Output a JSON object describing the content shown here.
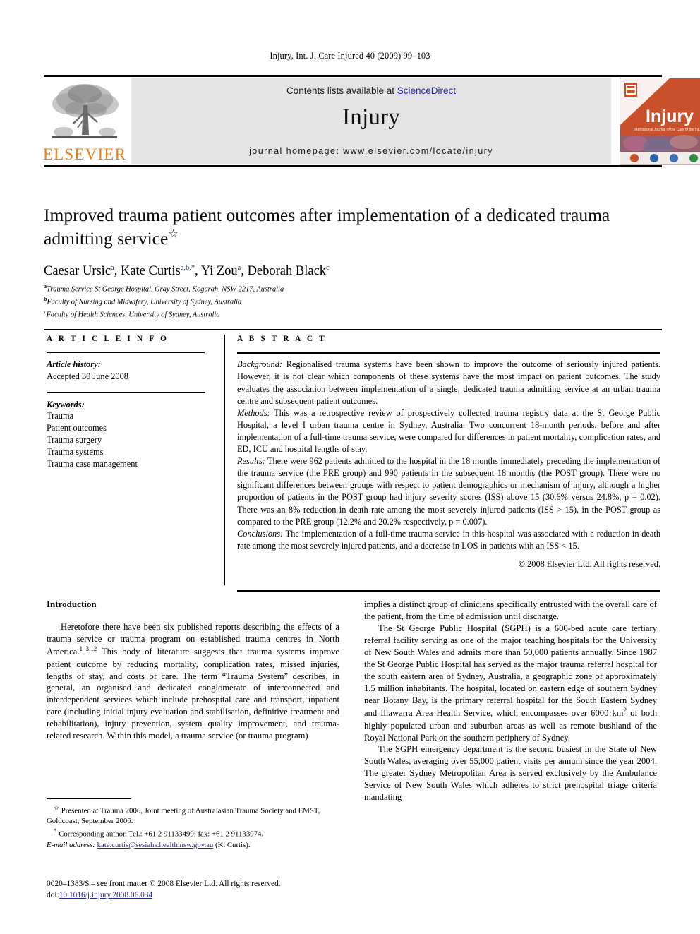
{
  "running_head": "Injury, Int. J. Care Injured 40 (2009) 99–103",
  "masthead": {
    "publisher_wordmark": "ELSEVIER",
    "contents_prefix": "Contents lists available at ",
    "contents_link": "ScienceDirect",
    "journal_name": "Injury",
    "homepage": "journal homepage: www.elsevier.com/locate/injury",
    "cover_title": "Injury",
    "cover_subtitle": "International Journal of the Care of the Injured",
    "colors": {
      "elsevier_orange": "#F07F13",
      "link_blue": "#2c2c8f",
      "banner_grey": "#e4e4e4",
      "cover_orange": "#C8502A"
    }
  },
  "article": {
    "title": "Improved trauma patient outcomes after implementation of a dedicated trauma admitting service",
    "title_symbol": "☆",
    "authors": [
      {
        "name": "Caesar Ursic",
        "sup": "a"
      },
      {
        "name": "Kate Curtis",
        "sup": "a,b,*"
      },
      {
        "name": "Yi Zou",
        "sup": "a"
      },
      {
        "name": "Deborah Black",
        "sup": "c"
      }
    ],
    "affiliations": [
      {
        "marker": "a",
        "text": "Trauma Service St George Hospital, Gray Street, Kogarah, NSW 2217, Australia"
      },
      {
        "marker": "b",
        "text": "Faculty of Nursing and Midwifery, University of Sydney, Australia"
      },
      {
        "marker": "c",
        "text": "Faculty of Health Sciences, University of Sydney, Australia"
      }
    ]
  },
  "article_info": {
    "heading": "A R T I C L E  I N F O",
    "history_label": "Article history:",
    "history_value": "Accepted 30 June 2008",
    "keywords_label": "Keywords:",
    "keywords": [
      "Trauma",
      "Patient outcomes",
      "Trauma surgery",
      "Trauma systems",
      "Trauma case management"
    ]
  },
  "abstract": {
    "heading": "A B S T R A C T",
    "sections": [
      {
        "label": "Background:",
        "text": " Regionalised trauma systems have been shown to improve the outcome of seriously injured patients. However, it is not clear which components of these systems have the most impact on patient outcomes. The study evaluates the association between implementation of a single, dedicated trauma admitting service at an urban trauma centre and subsequent patient outcomes."
      },
      {
        "label": "Methods:",
        "text": " This was a retrospective review of prospectively collected trauma registry data at the St George Public Hospital, a level I urban trauma centre in Sydney, Australia. Two concurrent 18-month periods, before and after implementation of a full-time trauma service, were compared for differences in patient mortality, complication rates, and ED, ICU and hospital lengths of stay."
      },
      {
        "label": "Results:",
        "text": " There were 962 patients admitted to the hospital in the 18 months immediately preceding the implementation of the trauma service (the PRE group) and 990 patients in the subsequent 18 months (the POST group). There were no significant differences between groups with respect to patient demographics or mechanism of injury, although a higher proportion of patients in the POST group had injury severity scores (ISS) above 15 (30.6% versus 24.8%, p = 0.02). There was an 8% reduction in death rate among the most severely injured patients (ISS > 15), in the POST group as compared to the PRE group (12.2% and 20.2% respectively, p = 0.007)."
      },
      {
        "label": "Conclusions:",
        "text": " The implementation of a full-time trauma service in this hospital was associated with a reduction in death rate among the most severely injured patients, and a decrease in LOS in patients with an ISS < 15."
      }
    ],
    "copyright": "© 2008 Elsevier Ltd. All rights reserved."
  },
  "body": {
    "section_heading": "Introduction",
    "left_paragraph_1": "Heretofore there have been six published reports describing the effects of a trauma service or trauma program on established trauma centres in North America.",
    "left_ref_1": "1–3,12",
    "left_paragraph_1_cont": " This body of literature suggests that trauma systems improve patient outcome by reducing mortality, complication rates, missed injuries, lengths of stay, and costs of care. The term “Trauma System” describes, in general, an organised and dedicated conglomerate of interconnected and interdependent services which include prehospital care and transport, inpatient care (including initial injury evaluation and stabilisation, definitive treatment and rehabilitation), injury prevention, system quality improvement, and trauma-related research. Within this model, a trauma service (or trauma program)",
    "right_paragraph_1": "implies a distinct group of clinicians specifically entrusted with the overall care of the patient, from the time of admission until discharge.",
    "right_paragraph_2": "The St George Public Hospital (SGPH) is a 600-bed acute care tertiary referral facility serving as one of the major teaching hospitals for the University of New South Wales and admits more than 50,000 patients annually. Since 1987 the St George Public Hospital has served as the major trauma referral hospital for the south eastern area of Sydney, Australia, a geographic zone of approximately 1.5 million inhabitants. The hospital, located on eastern edge of southern Sydney near Botany Bay, is the primary referral hospital for the South Eastern Sydney and Illawarra Area Health Service, which encompasses over 6000 km",
    "right_paragraph_2_sup": "2",
    "right_paragraph_2_cont": " of both highly populated urban and suburban areas as well as remote bushland of the Royal National Park on the southern periphery of Sydney.",
    "right_paragraph_3": "The SGPH emergency department is the second busiest in the State of New South Wales, averaging over 55,000 patient visits per annum since the year 2004. The greater Sydney Metropolitan Area is served exclusively by the Ambulance Service of New South Wales which adheres to strict prehospital triage criteria mandating"
  },
  "footnotes": {
    "star_note": "Presented at Trauma 2006, Joint meeting of Australasian Trauma Society and EMST, Goldcoast, September 2006.",
    "star_symbol": "☆",
    "corresponding_symbol": "*",
    "corresponding_note": "Corresponding author. Tel.: +61 2 91133499; fax: +61 2 91133974.",
    "email_label": "E-mail address:",
    "email": "kate.curtis@sesiahs.health.nsw.gov.au",
    "email_owner": "(K. Curtis)."
  },
  "front_matter": {
    "line1": "0020–1383/$ – see front matter © 2008 Elsevier Ltd. All rights reserved.",
    "doi_label": "doi:",
    "doi_value": "10.1016/j.injury.2008.06.034"
  }
}
